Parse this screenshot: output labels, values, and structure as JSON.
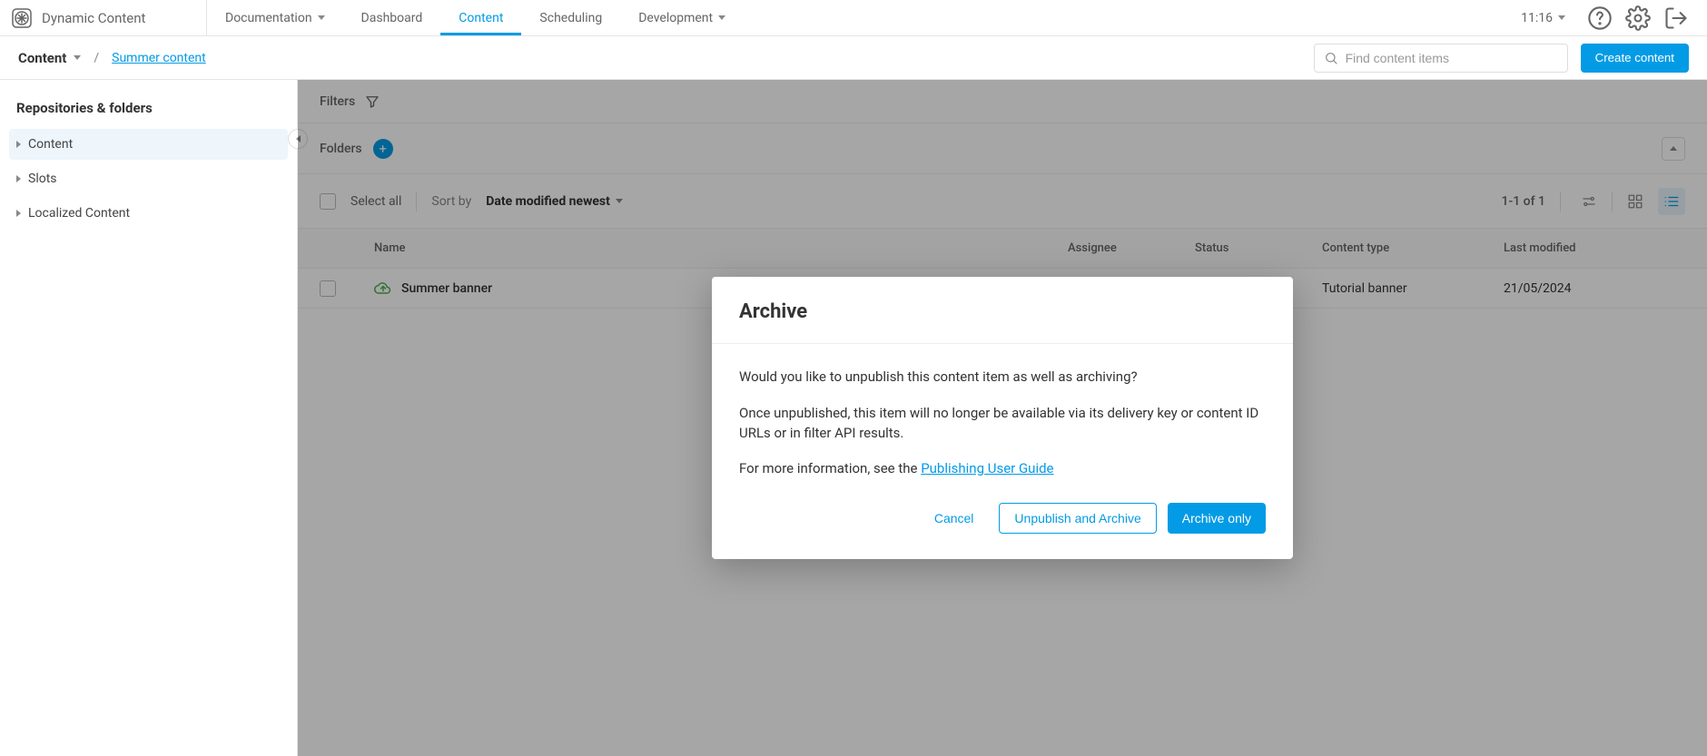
{
  "brand": {
    "name": "Dynamic Content"
  },
  "topnav": {
    "items": [
      {
        "label": "Documentation",
        "has_dropdown": true
      },
      {
        "label": "Dashboard"
      },
      {
        "label": "Content",
        "active": true
      },
      {
        "label": "Scheduling"
      },
      {
        "label": "Development",
        "has_dropdown": true
      }
    ],
    "clock": "11:16"
  },
  "subhead": {
    "content_label": "Content",
    "breadcrumb_separator": "/",
    "breadcrumb_current": "Summer content",
    "search_placeholder": "Find content items",
    "create_button": "Create content"
  },
  "sidebar": {
    "title": "Repositories & folders",
    "items": [
      {
        "label": "Content",
        "selected": true
      },
      {
        "label": "Slots"
      },
      {
        "label": "Localized Content"
      }
    ]
  },
  "filters": {
    "label": "Filters"
  },
  "folders": {
    "label": "Folders",
    "add_tooltip": "Add folder"
  },
  "toolbar": {
    "select_all": "Select all",
    "sort_by_label": "Sort by",
    "sort_by_value": "Date modified newest",
    "pagination": "1-1 of 1"
  },
  "columns": {
    "name": "Name",
    "assignee": "Assignee",
    "status": "Status",
    "content_type": "Content type",
    "last_modified": "Last modified"
  },
  "rows": [
    {
      "name": "Summer banner",
      "content_type": "Tutorial banner",
      "last_modified": "21/05/2024"
    }
  ],
  "modal": {
    "title": "Archive",
    "line1": "Would you like to unpublish this content item as well as archiving?",
    "line2": "Once unpublished, this item will no longer be available via its delivery key or content ID URLs or in filter API results.",
    "line3_prefix": "For more information, see the ",
    "line3_link": "Publishing User Guide",
    "cancel": "Cancel",
    "unpublish_and_archive": "Unpublish and Archive",
    "archive_only": "Archive only"
  },
  "colors": {
    "accent": "#039be5"
  }
}
